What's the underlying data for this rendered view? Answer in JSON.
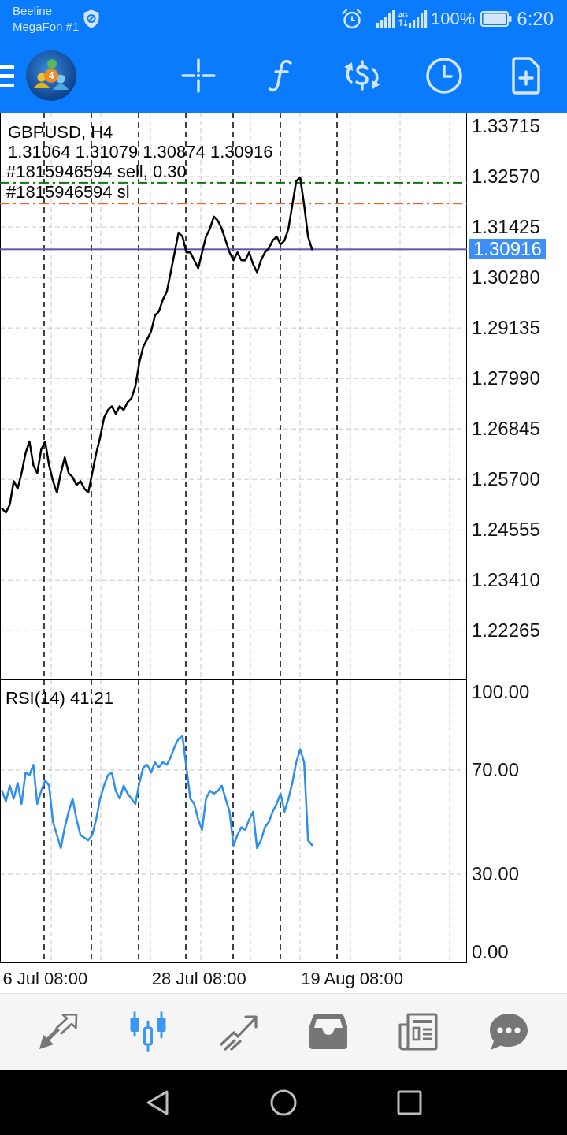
{
  "status_bar": {
    "carriers": [
      "Beeline",
      "MegaFon #1"
    ],
    "network": "4G",
    "battery": "100%",
    "time": "6:20"
  },
  "toolbar": {
    "logo_badge": "4"
  },
  "price_chart": {
    "symbol": "GBPUSD, H4",
    "ohlc": "1.31064 1.31079 1.30874 1.30916",
    "current_price": "1.30916",
    "chart_data": {
      "type": "line",
      "values": [
        1.2504,
        1.2495,
        1.2513,
        1.2566,
        1.2549,
        1.2584,
        1.2629,
        1.2656,
        1.2602,
        1.2584,
        1.2638,
        1.2656,
        1.2602,
        1.2566,
        1.254,
        1.2584,
        1.262,
        1.2584,
        1.2575,
        1.2557,
        1.2566,
        1.2549,
        1.254,
        1.2584,
        1.2629,
        1.2665,
        1.271,
        1.2727,
        1.2736,
        1.2719,
        1.2736,
        1.2727,
        1.2745,
        1.2754,
        1.2781,
        1.2835,
        1.2871,
        1.2888,
        1.2906,
        1.2942,
        1.2951,
        1.2978,
        1.2996,
        1.304,
        1.3085,
        1.313,
        1.3121,
        1.3085,
        1.3085,
        1.3067,
        1.3049,
        1.3085,
        1.3121,
        1.3139,
        1.3166,
        1.3157,
        1.3139,
        1.3112,
        1.3085,
        1.3067,
        1.3085,
        1.3067,
        1.3067,
        1.3085,
        1.3058,
        1.304,
        1.3067,
        1.3085,
        1.3094,
        1.3112,
        1.3121,
        1.3103,
        1.3112,
        1.3139,
        1.3193,
        1.3247,
        1.3255,
        1.3193,
        1.3121,
        1.3092,
        null,
        null,
        null,
        null,
        null,
        null,
        null,
        null,
        null,
        null,
        null,
        null,
        null,
        null,
        null,
        null,
        null,
        null,
        null,
        null,
        null,
        null,
        null,
        null,
        null,
        null,
        null,
        null,
        null,
        null,
        null,
        null,
        null,
        null,
        null,
        null,
        null,
        null,
        null
      ],
      "ylim": [
        1.2116,
        1.3402
      ],
      "yticks": [
        {
          "value": 1.33715,
          "label": "1.33715"
        },
        {
          "value": 1.3257,
          "label": "1.32570"
        },
        {
          "value": 1.31425,
          "label": "1.31425"
        },
        {
          "value": 1.3028,
          "label": "1.30280"
        },
        {
          "value": 1.29135,
          "label": "1.29135"
        },
        {
          "value": 1.2799,
          "label": "1.27990"
        },
        {
          "value": 1.26845,
          "label": "1.26845"
        },
        {
          "value": 1.257,
          "label": "1.25700"
        },
        {
          "value": 1.24555,
          "label": "1.24555"
        },
        {
          "value": 1.2341,
          "label": "1.23410"
        },
        {
          "value": 1.22265,
          "label": "1.22265"
        }
      ],
      "grid": true,
      "ref_lines": [
        {
          "axis": "y",
          "value": 1.3243,
          "label": "#1815946594 sell, 0.30",
          "color": "#0a7a0a"
        },
        {
          "axis": "y",
          "value": 1.3196,
          "label": "#1815946594 sl",
          "color": "#e2662a"
        },
        {
          "axis": "y",
          "value": 1.3092,
          "color": "#5b55b0"
        }
      ]
    }
  },
  "rsi": {
    "label": "RSI(14) 41.21",
    "chart_data": {
      "type": "line",
      "values": [
        62,
        58,
        64,
        59,
        65,
        57,
        69,
        68,
        72,
        57,
        62,
        66,
        64,
        50,
        45,
        40,
        48,
        54,
        59,
        51,
        45,
        44,
        43,
        45,
        51,
        59,
        64,
        68,
        69,
        62,
        59,
        64,
        61,
        59,
        57,
        65,
        71,
        72,
        69,
        73,
        71,
        73,
        72,
        75,
        79,
        82,
        83,
        71,
        59,
        57,
        51,
        47,
        59,
        62,
        61,
        62,
        64,
        59,
        54,
        41,
        45,
        48,
        47,
        51,
        54,
        40,
        43,
        48,
        50,
        54,
        57,
        61,
        54,
        59,
        65,
        73,
        78,
        73,
        43,
        41.2,
        null,
        null,
        null,
        null,
        null,
        null,
        null,
        null,
        null,
        null,
        null,
        null,
        null,
        null,
        null,
        null,
        null,
        null,
        null,
        null,
        null,
        null,
        null,
        null,
        null,
        null,
        null,
        null,
        null,
        null,
        null,
        null,
        null,
        null,
        null,
        null,
        null,
        null,
        null
      ],
      "ylim": [
        -4.2,
        104.8
      ],
      "yticks": [
        {
          "value": 100,
          "label": "100.00"
        },
        {
          "value": 70,
          "label": "70.00"
        },
        {
          "value": 30,
          "label": "30.00"
        },
        {
          "value": 0,
          "label": "0.00"
        }
      ],
      "grid": true
    }
  },
  "time_axis": [
    "6 Jul 08:00",
    "28 Jul 08:00",
    "19 Aug 08:00"
  ],
  "bottom_nav": [
    {
      "selected": false
    },
    {
      "selected": true
    },
    {
      "selected": false
    },
    {
      "selected": false
    },
    {
      "selected": false
    },
    {
      "selected": false
    }
  ]
}
